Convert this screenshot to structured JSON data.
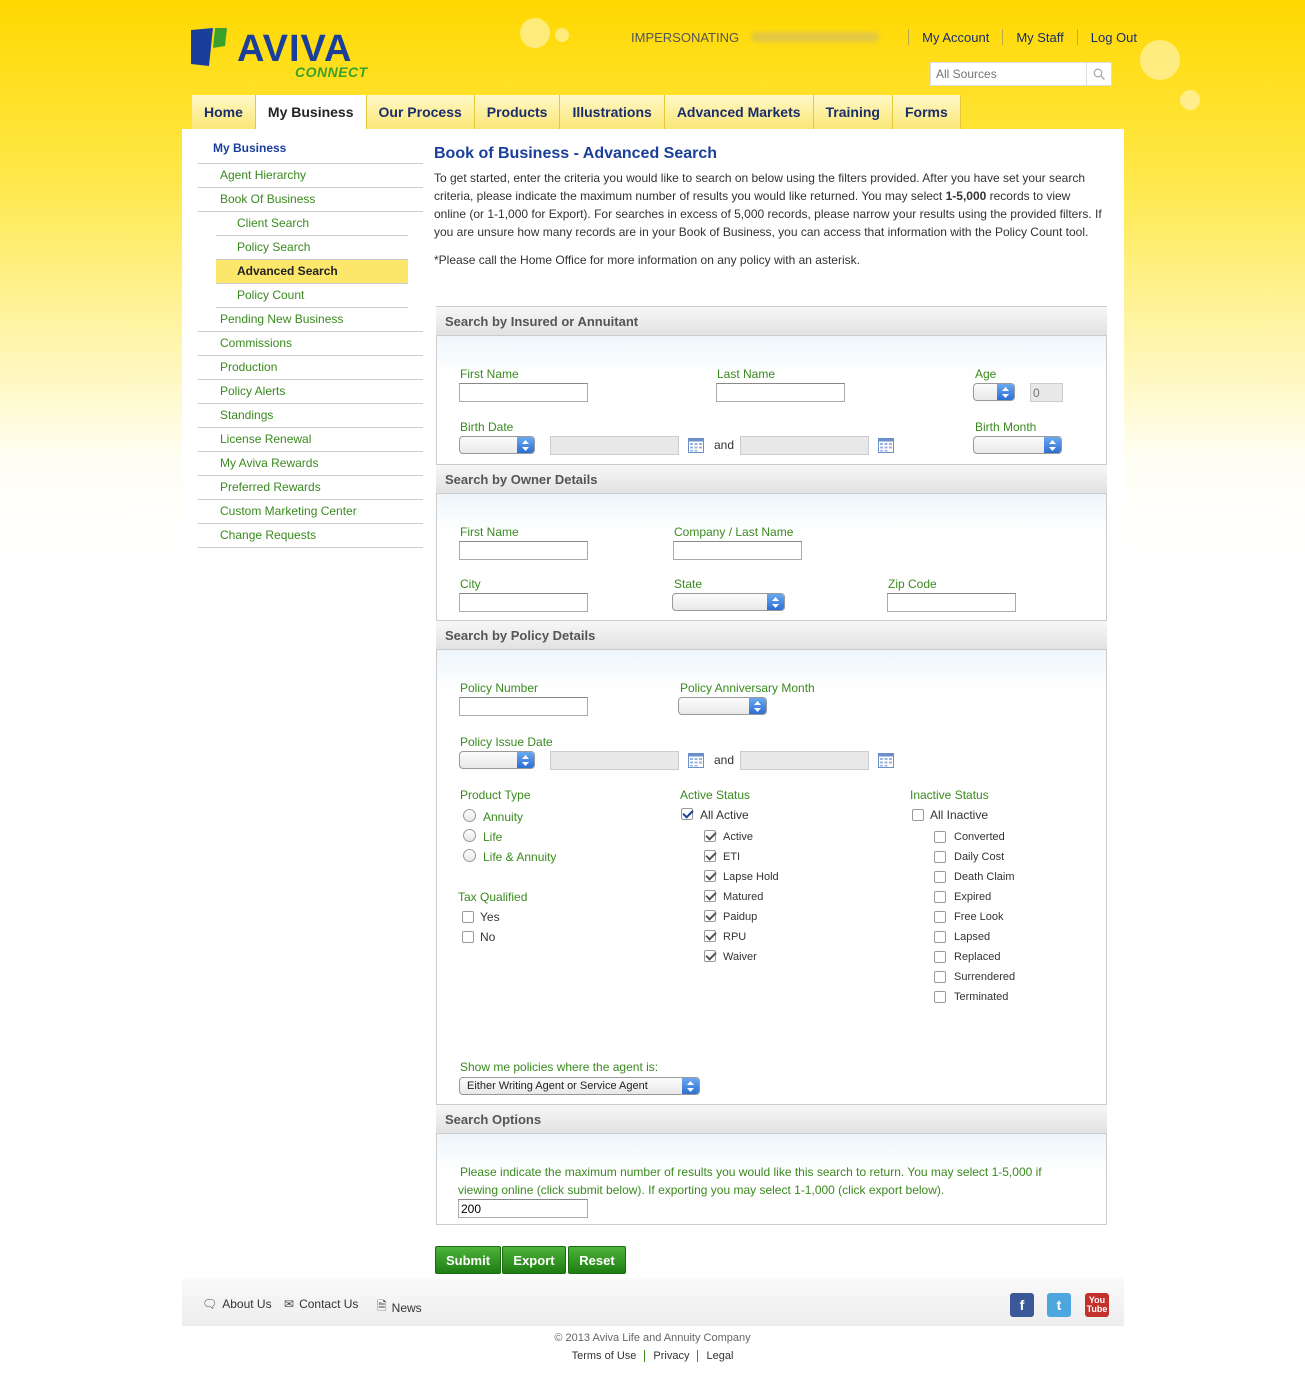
{
  "header": {
    "logo_text": "AVIVA",
    "logo_sub": "CONNECT",
    "impersonating_label": "IMPERSONATING",
    "links": [
      "My Account",
      "My Staff",
      "Log Out"
    ],
    "search_placeholder": "All Sources"
  },
  "nav": {
    "tabs": [
      "Home",
      "My Business",
      "Our Process",
      "Products",
      "Illustrations",
      "Advanced Markets",
      "Training",
      "Forms"
    ],
    "active": "My Business"
  },
  "sidebar": {
    "heading": "My Business",
    "items": [
      "Agent Hierarchy",
      "Book Of Business",
      "Client Search",
      "Policy Search",
      "Advanced Search",
      "Policy Count",
      "Pending New Business",
      "Commissions",
      "Production",
      "Policy Alerts",
      "Standings",
      "License Renewal",
      "My Aviva Rewards",
      "Preferred Rewards",
      "Custom Marketing Center",
      "Change Requests"
    ],
    "current": "Advanced Search"
  },
  "page": {
    "title": "Book of Business - Advanced Search",
    "intro_a": "To get started, enter the criteria you would like to search on below using the filters provided. After you have set your search criteria, please indicate the maximum number of results you would like returned. You may select ",
    "intro_bold": "1-5,000",
    "intro_b": " records to view online (or 1-1,000 for Export). For searches in excess of 5,000 records, please narrow your results using the provided filters. If you are unsure how many records are in your Book of Business, you can access that information with the Policy Count tool.",
    "note": "*Please call the Home Office for more information on any policy with an asterisk."
  },
  "insured": {
    "section": "Search by Insured or Annuitant",
    "first_name": "First Name",
    "last_name": "Last Name",
    "age": "Age",
    "age_value": "0",
    "birth_date": "Birth Date",
    "and": "and",
    "birth_month": "Birth Month"
  },
  "owner": {
    "section": "Search by Owner Details",
    "first_name": "First Name",
    "company": "Company / Last Name",
    "city": "City",
    "state": "State",
    "zip": "Zip Code"
  },
  "policy": {
    "section": "Search by Policy Details",
    "policy_number": "Policy Number",
    "anniversary": "Policy Anniversary Month",
    "issue_date": "Policy Issue Date",
    "and": "and",
    "product_type": "Product Type",
    "product_options": [
      "Annuity",
      "Life",
      "Life & Annuity"
    ],
    "tax_qualified": "Tax Qualified",
    "tax_options": [
      "Yes",
      "No"
    ],
    "active_status": "Active Status",
    "all_active": "All Active",
    "active_options": [
      "Active",
      "ETI",
      "Lapse Hold",
      "Matured",
      "Paidup",
      "RPU",
      "Waiver"
    ],
    "inactive_status": "Inactive Status",
    "all_inactive": "All Inactive",
    "inactive_options": [
      "Converted",
      "Daily Cost",
      "Death Claim",
      "Expired",
      "Free Look",
      "Lapsed",
      "Replaced",
      "Surrendered",
      "Terminated"
    ],
    "agent_label": "Show me policies where the agent is:",
    "agent_value": "Either Writing Agent or Service Agent"
  },
  "options": {
    "section": "Search Options",
    "text": "Please indicate the maximum number of results you would like this search to return. You may select 1-5,000 if viewing online (click submit below). If exporting you may select 1-1,000 (click export below).",
    "max_results": "200"
  },
  "buttons": {
    "submit": "Submit",
    "export": "Export",
    "reset": "Reset"
  },
  "footer": {
    "links": [
      "About Us",
      "Contact Us",
      "News"
    ],
    "copyright": "© 2013 Aviva Life and Annuity Company",
    "legal": [
      "Terms of Use",
      "Privacy",
      "Legal"
    ]
  },
  "colors": {
    "brand_blue": "#1a3f9b",
    "brand_green": "#3a8a1e",
    "brand_yellow": "#ffd800"
  }
}
